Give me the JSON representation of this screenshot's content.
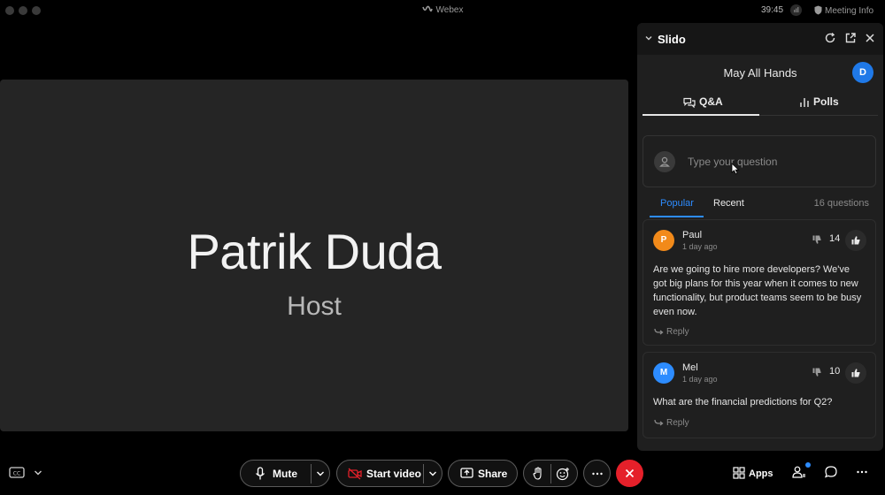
{
  "window": {
    "app_title": "Webex",
    "timer": "39:45",
    "meeting_info_label": "Meeting Info"
  },
  "stage": {
    "presenter_name": "Patrik Duda",
    "presenter_role": "Host"
  },
  "slido": {
    "title": "Slido",
    "event_title": "May All Hands",
    "user_initial": "D",
    "tabs": [
      {
        "label": "Q&A",
        "active": true
      },
      {
        "label": "Polls",
        "active": false
      }
    ],
    "ask_placeholder": "Type your question",
    "sort_tabs": [
      {
        "label": "Popular",
        "active": true
      },
      {
        "label": "Recent",
        "active": false
      }
    ],
    "question_count": "16 questions",
    "questions": [
      {
        "initial": "P",
        "avatar_color": "#f28a1a",
        "author": "Paul",
        "time": "1 day ago",
        "votes": "14",
        "text": "Are we going to hire more developers? We've got big plans for this year when it comes to new functionality, but product teams seem to be busy even now.",
        "reply_label": "Reply"
      },
      {
        "initial": "M",
        "avatar_color": "#2d8cff",
        "author": "Mel",
        "time": "1 day ago",
        "votes": "10",
        "text": "What are the financial predictions for Q2?",
        "reply_label": "Reply"
      }
    ]
  },
  "controls": {
    "mute_label": "Mute",
    "start_video_label": "Start video",
    "share_label": "Share",
    "apps_label": "Apps"
  },
  "colors": {
    "accent": "#2d8cff",
    "end_call": "#e5202a",
    "panel_bg": "#1f1f1f",
    "stage_bg": "#252525"
  },
  "icons": [
    "closed-captions-icon",
    "microphone-icon",
    "video-off-icon",
    "share-screen-icon",
    "raise-hand-icon",
    "reactions-icon",
    "more-icon",
    "end-call-icon",
    "apps-icon",
    "participants-icon",
    "chat-icon",
    "refresh-icon",
    "pop-out-icon",
    "close-icon",
    "thumbs-up-icon",
    "thumbs-down-icon",
    "reply-icon"
  ]
}
